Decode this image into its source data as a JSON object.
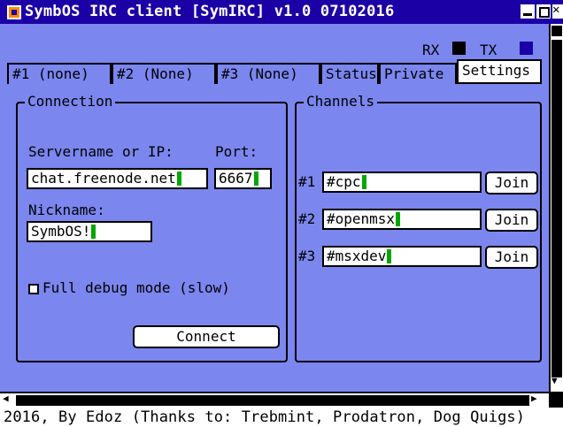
{
  "window": {
    "title": "SymbOS IRC client [SymIRC] v1.0 07102016"
  },
  "status": {
    "rx_label": "RX",
    "tx_label": "TX",
    "rx_color": "#000000",
    "tx_color": "#1b00a6"
  },
  "tabs": [
    {
      "label": "#1 (none)",
      "active": false
    },
    {
      "label": "#2 (None)",
      "active": false
    },
    {
      "label": "#3 (None)",
      "active": false
    },
    {
      "label": "Status",
      "active": false
    },
    {
      "label": "Private",
      "active": false
    },
    {
      "label": "Settings",
      "active": true
    }
  ],
  "connection": {
    "panel_label": "Connection",
    "server_label": "Servername or IP:",
    "port_label": "Port:",
    "server_value": "chat.freenode.net",
    "port_value": "6667",
    "nick_label": "Nickname:",
    "nick_value": "SymbOS!",
    "debug_label": "Full debug mode (slow)",
    "debug_checked": false,
    "connect_label": "Connect"
  },
  "channels": {
    "panel_label": "Channels",
    "items": [
      {
        "num": "#1",
        "value": "#cpc",
        "join_label": "Join"
      },
      {
        "num": "#2",
        "value": "#openmsx",
        "join_label": "Join"
      },
      {
        "num": "#3",
        "value": "#msxdev",
        "join_label": "Join"
      }
    ]
  },
  "footer": {
    "text": "2016, By Edoz (Thanks to: Trebmint, Prodatron, Dog Quigs)"
  },
  "colors": {
    "title_bar": "#1b00a6",
    "client_bg": "#7b86ef",
    "cursor": "#00a800",
    "app_icon": "#ff8a00"
  }
}
